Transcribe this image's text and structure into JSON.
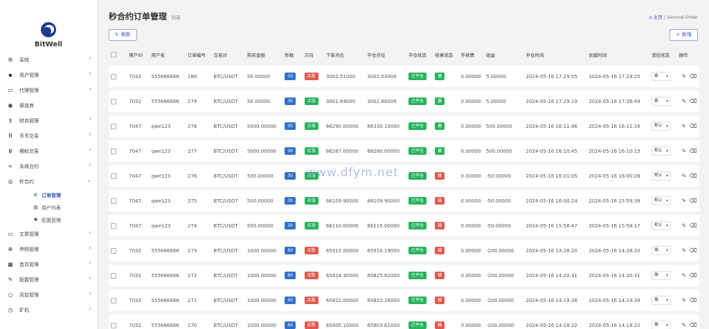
{
  "brand": {
    "name": "BitWell"
  },
  "nav": [
    {
      "label": "系统",
      "icon": "gear-icon",
      "glyph": "⚙",
      "arrow": "‹"
    },
    {
      "label": "用户管理",
      "icon": "user-icon",
      "glyph": "▪",
      "arrow": "‹"
    },
    {
      "label": "代理管理",
      "icon": "id-card-icon",
      "glyph": "▭",
      "arrow": "‹"
    },
    {
      "label": "渠道商",
      "icon": "user-circle-icon",
      "glyph": "◉",
      "arrow": ""
    },
    {
      "label": "财务管理",
      "icon": "dollar-icon",
      "glyph": "$",
      "arrow": "‹"
    },
    {
      "label": "币币交易",
      "icon": "bitcoin-icon",
      "glyph": "B",
      "arrow": "‹"
    },
    {
      "label": "期权交易",
      "icon": "bitcoin-small-icon",
      "glyph": "฿",
      "arrow": "‹"
    },
    {
      "label": "永续合约",
      "icon": "link-icon",
      "glyph": "∞",
      "arrow": "‹"
    },
    {
      "label": "秒合约",
      "icon": "target-icon",
      "glyph": "◎",
      "arrow": "⌄"
    }
  ],
  "subnav": [
    {
      "label": "订单管理",
      "icon": "list-icon",
      "glyph": "≡",
      "active": true
    },
    {
      "label": "用户列表",
      "icon": "file-icon",
      "glyph": "▤",
      "active": false
    },
    {
      "label": "配置管理",
      "icon": "cog-icon",
      "glyph": "✱",
      "active": false
    }
  ],
  "nav2": [
    {
      "label": "文章管理",
      "icon": "card-icon",
      "glyph": "▭",
      "arrow": "‹"
    },
    {
      "label": "申购管理",
      "icon": "plus-circle-icon",
      "glyph": "⊕",
      "arrow": "‹"
    },
    {
      "label": "首页管理",
      "icon": "list-box-icon",
      "glyph": "▦",
      "arrow": "‹"
    },
    {
      "label": "配置管理",
      "icon": "wrench-icon",
      "glyph": "✎",
      "arrow": "‹"
    },
    {
      "label": "风控管理",
      "icon": "shield-circle-icon",
      "glyph": "○",
      "arrow": "‹"
    },
    {
      "label": "矿机",
      "icon": "clock-icon",
      "glyph": "◷",
      "arrow": "‹"
    }
  ],
  "page": {
    "title": "秒合约订单管理",
    "subtitle": "列表"
  },
  "breadcrumb": {
    "home": "主页",
    "sep": "/",
    "current": "Second-Order"
  },
  "toolbar": {
    "refresh_label": "刷新",
    "add_label": "新增"
  },
  "columns": [
    "用户ID",
    "用户名",
    "订单编号",
    "交易对",
    "购买金额",
    "秒数",
    "方向",
    "下单点位",
    "平仓点位",
    "平仓状态",
    "结果状态",
    "手续费",
    "收益",
    "平仓时间",
    "创建时间",
    "营控状态",
    "操作"
  ],
  "rows": [
    {
      "uid": "7032",
      "username": "555666888",
      "order_no": "280",
      "pair": "BTC/USDT",
      "amount": "50.00000",
      "seconds": "30",
      "direction": "买跌",
      "dir_color": "red",
      "open_price": "3002.51000",
      "close_price": "3002.03000",
      "close_status": "已平仓",
      "result": "赢",
      "result_color": "green",
      "fee": "0.00000",
      "profit": "5.00000",
      "close_time": "2024-05-16 17:29:55",
      "create_time": "2024-05-16 17:29:25",
      "control": "赢"
    },
    {
      "uid": "7032",
      "username": "555666888",
      "order_no": "279",
      "pair": "BTC/USDT",
      "amount": "50.00000",
      "seconds": "30",
      "direction": "买涨",
      "dir_color": "green",
      "open_price": "3001.64000",
      "close_price": "3002.86000",
      "close_status": "已平仓",
      "result": "赢",
      "result_color": "green",
      "fee": "0.00000",
      "profit": "5.00000",
      "close_time": "2024-05-16 17:29:19",
      "create_time": "2024-05-16 17:28:49",
      "control": "赢"
    },
    {
      "uid": "7047",
      "username": "qwe123",
      "order_no": "278",
      "pair": "BTC/USDT",
      "amount": "5000.00000",
      "seconds": "30",
      "direction": "买涨",
      "dir_color": "green",
      "open_price": "66290.00000",
      "close_price": "66330.10000",
      "close_status": "已平仓",
      "result": "赢",
      "result_color": "green",
      "fee": "0.00000",
      "profit": "500.00000",
      "close_time": "2024-05-16 16:11:46",
      "create_time": "2024-05-16 16:11:16",
      "control": "默认"
    },
    {
      "uid": "7047",
      "username": "qwe123",
      "order_no": "277",
      "pair": "BTC/USDT",
      "amount": "5000.00000",
      "seconds": "30",
      "direction": "买涨",
      "dir_color": "green",
      "open_price": "66267.00000",
      "close_price": "66280.00000",
      "close_status": "已平仓",
      "result": "赢",
      "result_color": "green",
      "fee": "0.00000",
      "profit": "500.00000",
      "close_time": "2024-05-16 16:10:45",
      "create_time": "2024-05-16 16:10:15",
      "control": "默认"
    },
    {
      "uid": "7047",
      "username": "qwe123",
      "order_no": "276",
      "pair": "BTC/USDT",
      "amount": "500.00000",
      "seconds": "30",
      "direction": "买涨",
      "dir_color": "green",
      "open_price": "",
      "close_price": "",
      "close_status": "已平仓",
      "result": "输",
      "result_color": "red",
      "fee": "0.00000",
      "profit": "-50.00000",
      "close_time": "2024-05-16 16:01:05",
      "create_time": "2024-05-16 16:00:28",
      "control": "默认"
    },
    {
      "uid": "7047",
      "username": "qwe123",
      "order_no": "275",
      "pair": "BTC/USDT",
      "amount": "500.00000",
      "seconds": "30",
      "direction": "买涨",
      "dir_color": "green",
      "open_price": "66109.90000",
      "close_price": "66109.90000",
      "close_status": "已平仓",
      "result": "输",
      "result_color": "red",
      "fee": "0.00000",
      "profit": "-50.00000",
      "close_time": "2024-05-16 16:00:24",
      "create_time": "2024-05-16 15:59:38",
      "control": "默认"
    },
    {
      "uid": "7047",
      "username": "qwe123",
      "order_no": "274",
      "pair": "BTC/USDT",
      "amount": "500.00000",
      "seconds": "30",
      "direction": "买涨",
      "dir_color": "green",
      "open_price": "66110.00000",
      "close_price": "66110.00000",
      "close_status": "已平仓",
      "result": "输",
      "result_color": "red",
      "fee": "0.00000",
      "profit": "-50.00000",
      "close_time": "2024-05-16 15:58:47",
      "create_time": "2024-05-16 15:58:17",
      "control": "默认"
    },
    {
      "uid": "7032",
      "username": "555666888",
      "order_no": "273",
      "pair": "BTC/USDT",
      "amount": "1000.00000",
      "seconds": "60",
      "direction": "买跌",
      "dir_color": "red",
      "open_price": "65915.00000",
      "close_price": "65916.19000",
      "close_status": "已平仓",
      "result": "输",
      "result_color": "red",
      "fee": "0.00000",
      "profit": "-200.00000",
      "close_time": "2024-05-16 14:28:20",
      "create_time": "2024-05-16 14:28:20",
      "control": "输"
    },
    {
      "uid": "7032",
      "username": "555666888",
      "order_no": "272",
      "pair": "BTC/USDT",
      "amount": "1000.00000",
      "seconds": "60",
      "direction": "买跌",
      "dir_color": "red",
      "open_price": "65824.30000",
      "close_price": "65825.62000",
      "close_status": "已平仓",
      "result": "输",
      "result_color": "red",
      "fee": "0.00000",
      "profit": "-200.00000",
      "close_time": "2024-05-16 14:20:31",
      "create_time": "2024-05-16 14:20:31",
      "control": "输"
    },
    {
      "uid": "7032",
      "username": "555666888",
      "order_no": "271",
      "pair": "BTC/USDT",
      "amount": "1000.00000",
      "seconds": "60",
      "direction": "买跌",
      "dir_color": "red",
      "open_price": "65821.00000",
      "close_price": "65822.16000",
      "close_status": "已平仓",
      "result": "输",
      "result_color": "red",
      "fee": "0.00000",
      "profit": "-200.00000",
      "close_time": "2024-05-16 14:19:38",
      "create_time": "2024-05-16 14:19:38",
      "control": "输"
    },
    {
      "uid": "7032",
      "username": "555666888",
      "order_no": "270",
      "pair": "BTC/USDT",
      "amount": "1000.00000",
      "seconds": "60",
      "direction": "买跌",
      "dir_color": "red",
      "open_price": "65805.10000",
      "close_price": "65803.61000",
      "close_status": "已平仓",
      "result": "输",
      "result_color": "red",
      "fee": "0.00000",
      "profit": "-200.00000",
      "close_time": "2024-05-16 14:18:22",
      "create_time": "2024-05-16 14:18:22",
      "control": "输"
    }
  ],
  "watermark": "www.dfym.net",
  "colors": {
    "blue": "#2f72c9",
    "red": "#e05a4e",
    "green": "#27b25c",
    "accent": "#2c59b8"
  }
}
